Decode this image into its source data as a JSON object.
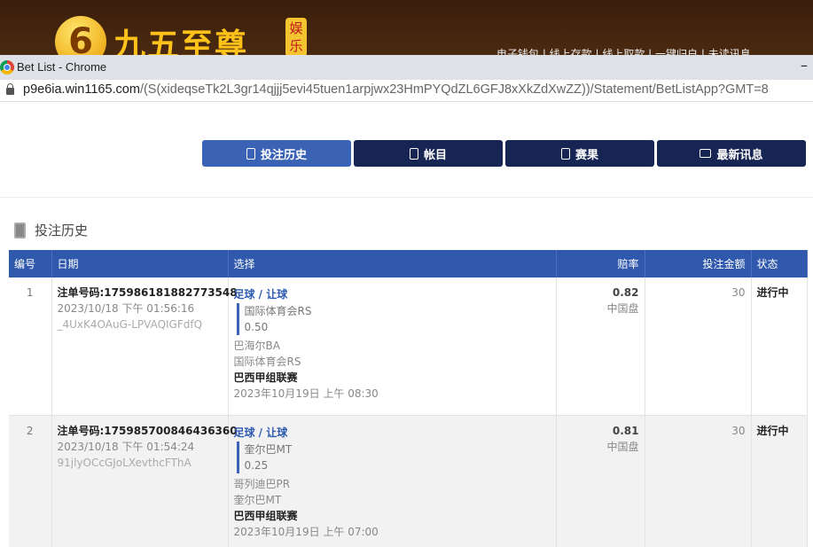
{
  "site": {
    "logo_digit": "6",
    "logo_text": "九五至尊",
    "logo_badge": "娱乐",
    "top_menu": "电子钱包 | 线上存款 | 线上取款 | 一键归户 | 未读讯息"
  },
  "window": {
    "title": "Bet List - Chrome",
    "minimize": "–"
  },
  "url": {
    "host": "p9e6ia.win1165.com",
    "path": "/(S(xideqseTk2L3gr14qjjj5evi45tuen1arpjwx23HmPYQdZL6GFJ8xXkZdXwZZ))/Statement/BetListApp?GMT=8"
  },
  "tabs": [
    {
      "label": "投注历史",
      "icon": "clipboard-icon"
    },
    {
      "label": "帐目",
      "icon": "ledger-icon"
    },
    {
      "label": "赛果",
      "icon": "results-icon"
    },
    {
      "label": "最新讯息",
      "icon": "mail-icon"
    }
  ],
  "section_title": "投注历史",
  "table": {
    "headers": [
      "编号",
      "日期",
      "选择",
      "赔率",
      "投注金额",
      "状态"
    ],
    "rows": [
      {
        "no": "1",
        "bet_id": "注单号码:175986181882773548",
        "datetime": "2023/10/18 下午 01:56:16",
        "ref": "_4UxK4OAuG-LPVAQIGFdfQ",
        "sport": "足球 / 让球",
        "pick": "国际体育会RS",
        "handicap": "0.50",
        "home": "巴海尔BA",
        "away": "国际体育会RS",
        "league": "巴西甲组联赛",
        "match_time": "2023年10月19日 上午 08:30",
        "odds": "0.82",
        "odds_type": "中国盘",
        "stake": "30",
        "status": "进行中"
      },
      {
        "no": "2",
        "bet_id": "注单号码:175985700846436360",
        "datetime": "2023/10/18 下午 01:54:24",
        "ref": "91jlyOCcGJoLXevthcFThA",
        "sport": "足球 / 让球",
        "pick": "奎尔巴MT",
        "handicap": "0.25",
        "home": "哥列迪巴PR",
        "away": "奎尔巴MT",
        "league": "巴西甲组联赛",
        "match_time": "2023年10月19日 上午 07:00",
        "odds": "0.81",
        "odds_type": "中国盘",
        "stake": "30",
        "status": "进行中"
      }
    ]
  }
}
